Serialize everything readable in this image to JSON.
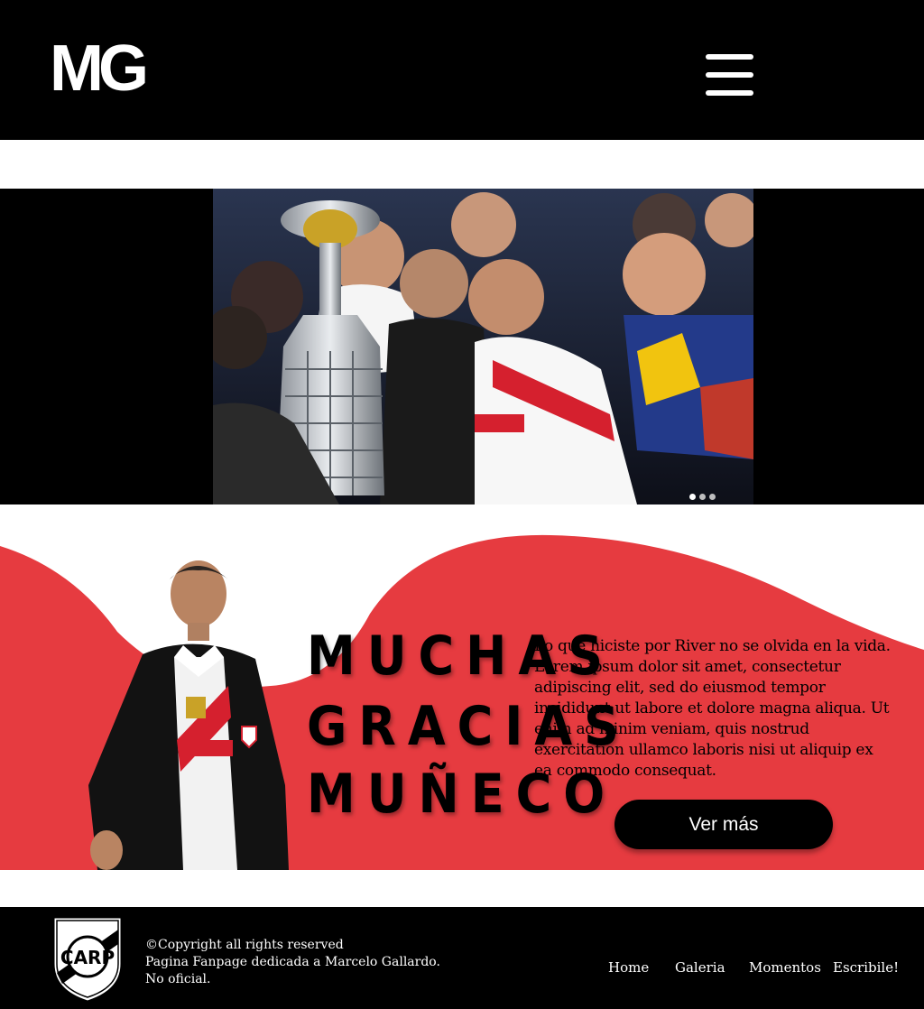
{
  "header": {
    "logo_text": "MG",
    "menu_icon": "hamburger-menu-icon"
  },
  "carousel": {
    "image_alt": "Players celebrating with the Copa Libertadores trophy",
    "slide_count": 3,
    "active_index": 0
  },
  "hero": {
    "words": [
      "MUCHAS",
      "GRACIAS",
      "MUÑECO"
    ],
    "paragraph": "Lo que hiciste por River no se olvida en la vida. Lorem ipsum dolor sit amet, consectetur adipiscing elit, sed do eiusmod tempor incididunt ut labore et dolore magna aliqua. Ut enim ad minim veniam, quis nostrud exercitation ullamco laboris nisi ut aliquip ex ea commodo consequat.",
    "button_label": "Ver más"
  },
  "footer": {
    "crest_icon": "river-plate-crest-icon",
    "copyright": "©Copyright all rights reserved",
    "line2": "Pagina Fanpage dedicada a Marcelo Gallardo.",
    "line3": "No oficial.",
    "nav": [
      "Home",
      "Galeria",
      "Momentos",
      "Escribile!"
    ]
  },
  "colors": {
    "black": "#000000",
    "accent_red": "#e63b40",
    "white": "#ffffff"
  }
}
